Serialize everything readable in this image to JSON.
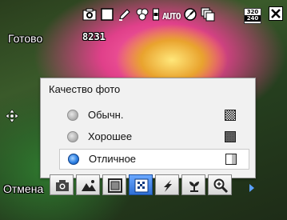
{
  "status": {
    "label": "Готово",
    "shot_counter": "8231"
  },
  "top_icons": [
    {
      "name": "camera-icon"
    },
    {
      "name": "frame-icon"
    },
    {
      "name": "edit-icon"
    },
    {
      "name": "effects-icon"
    },
    {
      "name": "flash-auto-icon",
      "text": "AUTO"
    },
    {
      "name": "timer-icon"
    },
    {
      "name": "burst-icon"
    }
  ],
  "resolution_badge": {
    "top": "320",
    "bottom": "240"
  },
  "popup": {
    "title": "Качество фото",
    "options": [
      {
        "label": "Обычн.",
        "selected": false,
        "icon": "quality-normal-icon"
      },
      {
        "label": "Хорошее",
        "selected": false,
        "icon": "quality-good-icon"
      },
      {
        "label": "Отличное",
        "selected": true,
        "icon": "quality-fine-icon"
      }
    ]
  },
  "softkey": {
    "cancel_label": "Отмена"
  },
  "toolbar": [
    {
      "name": "camera-mode-icon"
    },
    {
      "name": "scene-icon"
    },
    {
      "name": "frame-mode-icon"
    },
    {
      "name": "quality-icon",
      "active": true
    },
    {
      "name": "metering-icon"
    },
    {
      "name": "macro-icon"
    },
    {
      "name": "zoom-icon"
    }
  ],
  "colors": {
    "accent": "#2f6fd6",
    "popup_bg": "#f1f1f1"
  }
}
